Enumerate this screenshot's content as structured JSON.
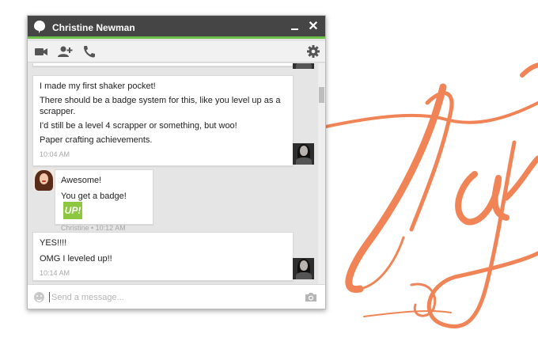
{
  "window": {
    "contact_name": "Christine Newman",
    "accent_color": "#6cc04a",
    "titlebar_color": "#454545"
  },
  "toolbar": {
    "icons": [
      "video-call-icon",
      "add-person-icon",
      "phone-icon",
      "settings-gear-icon"
    ]
  },
  "messages": [
    {
      "sender": "self",
      "lines": [
        "I made my first shaker pocket!",
        "There should be a badge system for this, like you level up as a scrapper.",
        "I'd still be a level 4 scrapper or something, but woo!",
        "Paper crafting achievements."
      ],
      "time": "10:04 AM"
    },
    {
      "sender": "Christine",
      "lines": [
        "Awesome!",
        "You get a badge!"
      ],
      "badge_text": "UP!",
      "time": "Christine • 10:12 AM"
    },
    {
      "sender": "self",
      "lines": [
        "YES!!!!",
        "OMG I leveled up!!"
      ],
      "time": "10:14 AM"
    }
  ],
  "composer": {
    "placeholder": "Send a message...",
    "value": ""
  },
  "background": {
    "art_color": "#f08456"
  }
}
